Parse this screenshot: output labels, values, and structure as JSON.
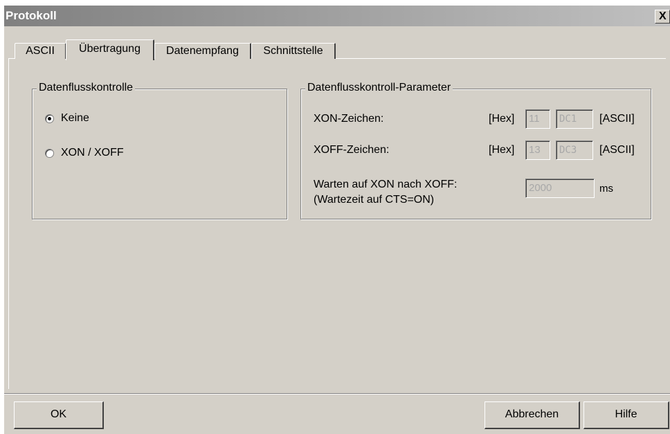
{
  "window": {
    "title": "Protokoll",
    "close_label": "X"
  },
  "tabs": [
    {
      "label": "ASCII",
      "active": false
    },
    {
      "label": "Übertragung",
      "active": true
    },
    {
      "label": "Datenempfang",
      "active": false
    },
    {
      "label": "Schnittstelle",
      "active": false
    }
  ],
  "flow_control": {
    "legend": "Datenflusskontrolle",
    "options": [
      {
        "label": "Keine",
        "checked": true
      },
      {
        "label": "XON / XOFF",
        "checked": false
      }
    ]
  },
  "parameters": {
    "legend": "Datenflusskontroll-Parameter",
    "xon": {
      "label": "XON-Zeichen:",
      "hex_label": "[Hex]",
      "hex_value": "11",
      "ascii_value": "DC1",
      "ascii_label": "[ASCII]"
    },
    "xoff": {
      "label": "XOFF-Zeichen:",
      "hex_label": "[Hex]",
      "hex_value": "13",
      "ascii_value": "DC3",
      "ascii_label": "[ASCII]"
    },
    "wait": {
      "label_line1": "Warten auf XON nach XOFF:",
      "label_line2": "(Wartezeit auf CTS=ON)",
      "value": "2000",
      "unit": "ms"
    }
  },
  "buttons": {
    "ok": "OK",
    "cancel": "Abbrechen",
    "help": "Hilfe"
  }
}
